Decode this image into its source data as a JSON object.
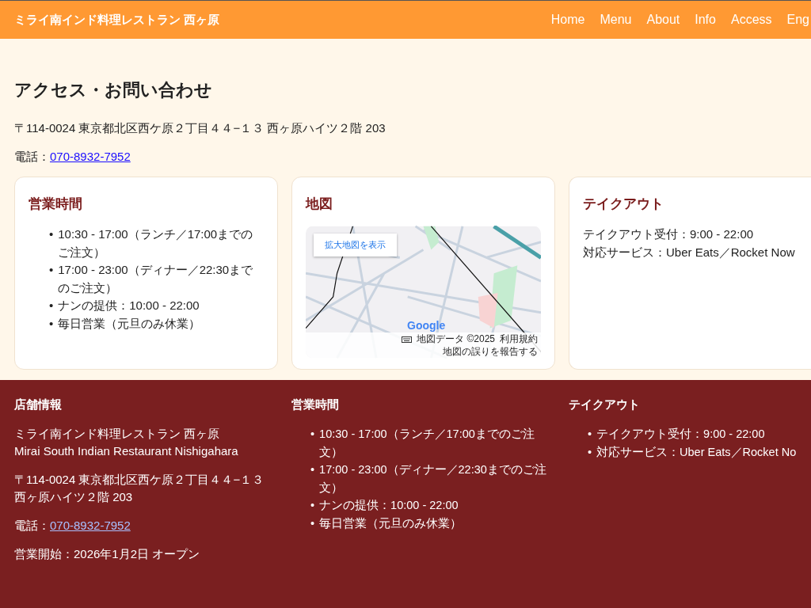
{
  "header": {
    "title": "ミライ南インド料理レストラン 西ヶ原",
    "nav": [
      "Home",
      "Menu",
      "About",
      "Info",
      "Access",
      "Eng"
    ]
  },
  "page": {
    "title": "アクセス・お問い合わせ",
    "address": "〒114-0024 東京都北区西ケ原２丁目４４−１３ 西ヶ原ハイツ２階 203",
    "phone_label": "電話：",
    "phone": "070-8932-7952"
  },
  "cards": [
    {
      "kind": "list",
      "title": "営業時間",
      "marker": "•",
      "items": [
        "10:30 - 17:00（ランチ／17:00までのご注文）",
        "17:00 - 23:00（ディナー／22:30までのご注文）",
        "ナンの提供：10:00 - 22:00",
        "毎日営業（元旦のみ休業）"
      ]
    },
    {
      "kind": "map",
      "title": "地図",
      "enlarge_button": "拡大地図を表示",
      "logo": "Google",
      "attribution": [
        "地図データ ©2025",
        "利用規約",
        "地図の誤りを報告する"
      ]
    },
    {
      "kind": "lines",
      "title": "テイクアウト",
      "lines": [
        "テイクアウト受付：9:00 - 22:00",
        "対応サービス：Uber Eats／Rocket Now"
      ]
    }
  ],
  "footer": {
    "columns": [
      {
        "title": "店舗情報",
        "blocks": [
          {
            "kind": "text",
            "lines": [
              "ミライ南インド料理レストラン 西ヶ原",
              "Mirai South Indian Restaurant Nishigahara"
            ]
          },
          {
            "kind": "text",
            "lines": [
              "〒114-0024 東京都北区西ケ原２丁目４４−１３",
              "西ヶ原ハイツ２階 203"
            ]
          },
          {
            "kind": "phone",
            "label": "電話：",
            "phone": "070-8932-7952"
          },
          {
            "kind": "text",
            "lines": [
              "営業開始：2026年1月2日 オープン"
            ]
          }
        ]
      },
      {
        "title": "営業時間",
        "blocks": [
          {
            "kind": "list",
            "marker": "•",
            "items": [
              "10:30 - 17:00（ランチ／17:00までのご注文）",
              "17:00 - 23:00（ディナー／22:30までのご注文）",
              "ナンの提供：10:00 - 22:00",
              "毎日営業（元旦のみ休業）"
            ]
          }
        ]
      },
      {
        "title": "テイクアウト",
        "blocks": [
          {
            "kind": "list",
            "marker": "•",
            "items": [
              "テイクアウト受付：9:00 - 22:00",
              "対応サービス：Uber Eats／Rocket No"
            ]
          }
        ]
      }
    ]
  }
}
